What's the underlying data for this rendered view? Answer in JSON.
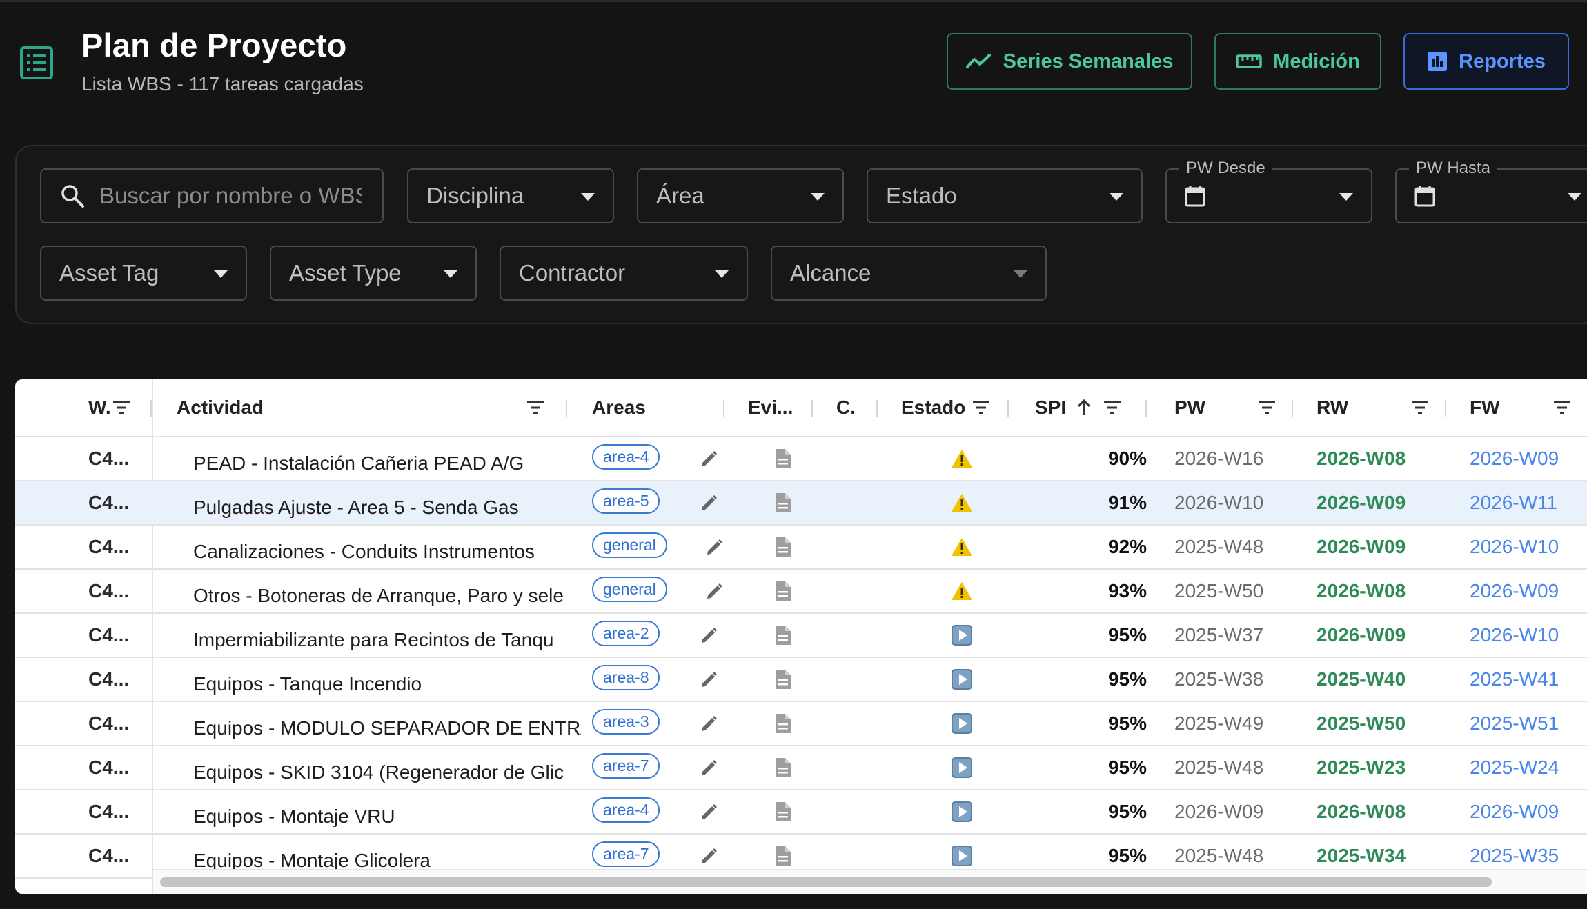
{
  "header": {
    "title": "Plan de Proyecto",
    "subtitle": "Lista WBS - 117 tareas cargadas",
    "app_icon": "list-icon",
    "buttons": [
      {
        "label": "Series Semanales",
        "icon": "trend-line-icon"
      },
      {
        "label": "Medición",
        "icon": "ruler-icon"
      },
      {
        "label": "Reportes",
        "icon": "bar-chart-icon"
      }
    ]
  },
  "filters": {
    "search_placeholder": "Buscar por nombre o WBS",
    "disciplina": "Disciplina",
    "area": "Área",
    "estado": "Estado",
    "pw_desde": "PW Desde",
    "pw_hasta": "PW Hasta",
    "asset_tag": "Asset Tag",
    "asset_type": "Asset Type",
    "contractor": "Contractor",
    "alcance": "Alcance"
  },
  "table": {
    "columns": {
      "wbs": "W.",
      "actividad": "Actividad",
      "areas": "Areas",
      "evidencia": "Evi...",
      "c": "C.",
      "estado": "Estado",
      "spi": "SPI",
      "pw": "PW",
      "rw": "RW",
      "fw": "FW"
    },
    "sort": {
      "column": "SPI",
      "direction": "asc"
    },
    "rows": [
      {
        "wbs": "C4...",
        "actividad": "PEAD - Instalación Cañeria PEAD A/G",
        "area": "area-4",
        "estado": "warning",
        "spi": "90%",
        "pw": "2026-W16",
        "rw": "2026-W08",
        "fw": "2026-W09"
      },
      {
        "wbs": "C4...",
        "actividad": "Pulgadas Ajuste - Area 5 - Senda Gas",
        "area": "area-5",
        "estado": "warning",
        "spi": "91%",
        "pw": "2026-W10",
        "rw": "2026-W09",
        "fw": "2026-W11",
        "selected": true
      },
      {
        "wbs": "C4...",
        "actividad": "Canalizaciones - Conduits Instrumentos",
        "area": "general",
        "estado": "warning",
        "spi": "92%",
        "pw": "2025-W48",
        "rw": "2026-W09",
        "fw": "2026-W10"
      },
      {
        "wbs": "C4...",
        "actividad": "Otros - Botoneras de Arranque, Paro y sele",
        "area": "general",
        "estado": "warning",
        "spi": "93%",
        "pw": "2025-W50",
        "rw": "2026-W08",
        "fw": "2026-W09"
      },
      {
        "wbs": "C4...",
        "actividad": "Impermiabilizante para Recintos de Tanqu",
        "area": "area-2",
        "estado": "in-progress",
        "spi": "95%",
        "pw": "2025-W37",
        "rw": "2026-W09",
        "fw": "2026-W10"
      },
      {
        "wbs": "C4...",
        "actividad": "Equipos - Tanque Incendio",
        "area": "area-8",
        "estado": "in-progress",
        "spi": "95%",
        "pw": "2025-W38",
        "rw": "2025-W40",
        "fw": "2025-W41"
      },
      {
        "wbs": "C4...",
        "actividad": "Equipos - MODULO SEPARADOR DE ENTRA",
        "area": "area-3",
        "estado": "in-progress",
        "spi": "95%",
        "pw": "2025-W49",
        "rw": "2025-W50",
        "fw": "2025-W51"
      },
      {
        "wbs": "C4...",
        "actividad": "Equipos - SKID 3104 (Regenerador de Glic",
        "area": "area-7",
        "estado": "in-progress",
        "spi": "95%",
        "pw": "2025-W48",
        "rw": "2025-W23",
        "fw": "2025-W24"
      },
      {
        "wbs": "C4...",
        "actividad": "Equipos - Montaje VRU",
        "area": "area-4",
        "estado": "in-progress",
        "spi": "95%",
        "pw": "2026-W09",
        "rw": "2026-W08",
        "fw": "2026-W09"
      },
      {
        "wbs": "C4...",
        "actividad": "Equipos - Montaje Glicolera",
        "area": "area-7",
        "estado": "in-progress",
        "spi": "95%",
        "pw": "2025-W48",
        "rw": "2025-W34",
        "fw": "2025-W35"
      }
    ]
  },
  "colors": {
    "accent_green": "#4cc79b",
    "accent_blue": "#5b93ff",
    "rw_green": "#2e8b57",
    "fw_blue": "#4a86e8",
    "warning_yellow": "#f2c200",
    "play_blue": "#6b8fb8"
  }
}
